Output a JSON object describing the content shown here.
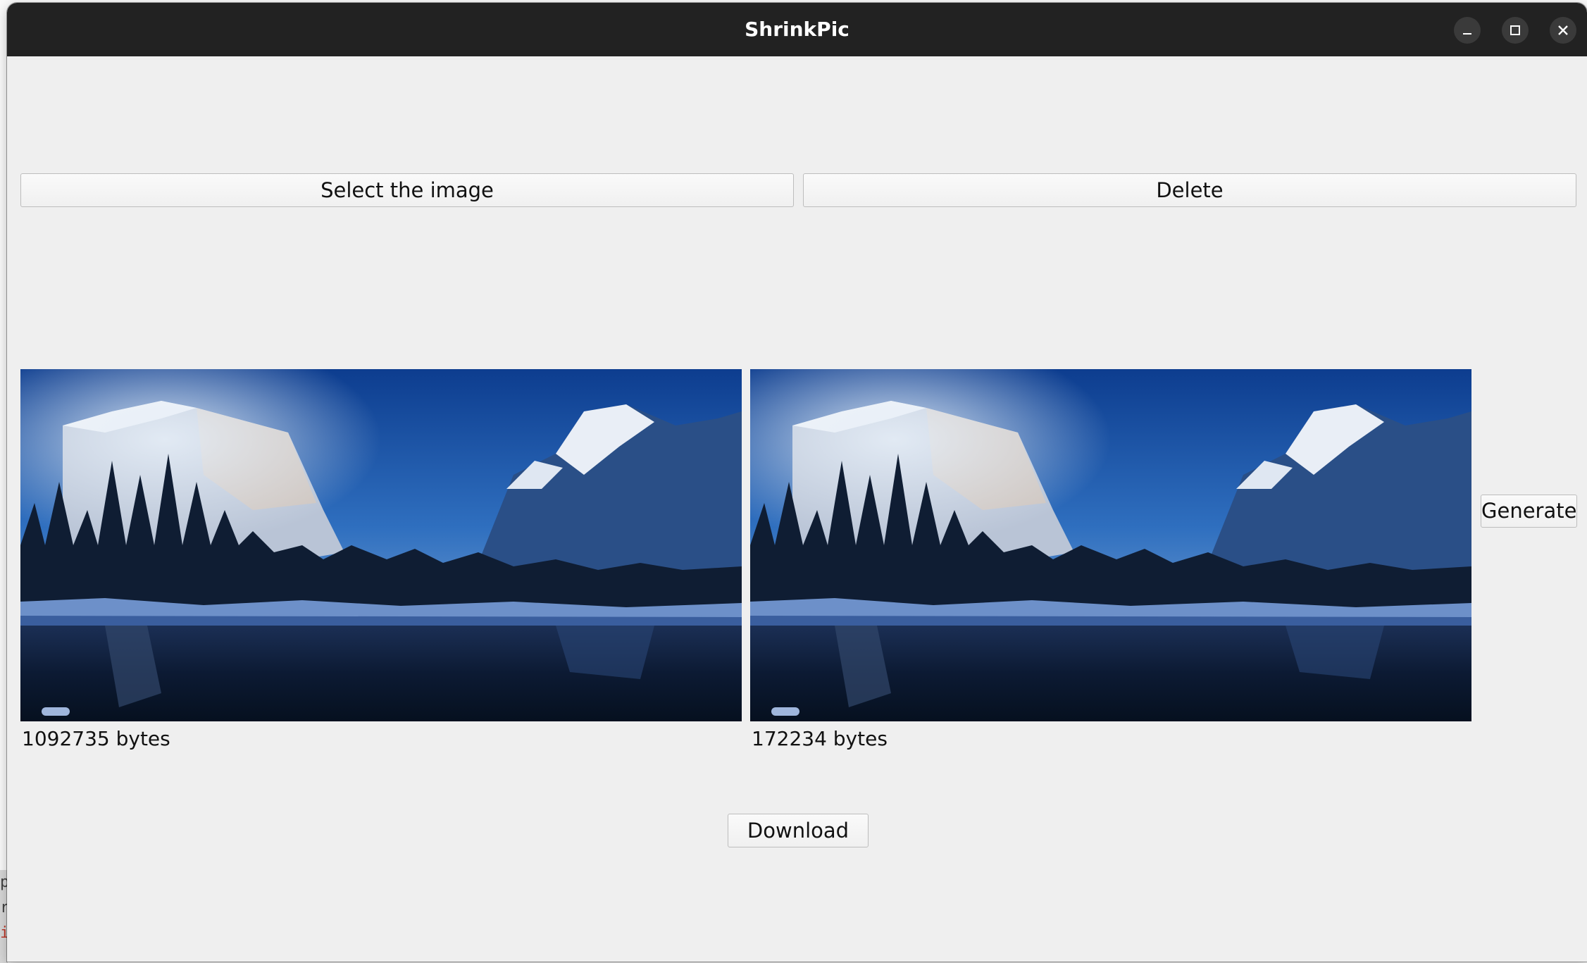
{
  "window": {
    "title": "ShrinkPic",
    "controls": {
      "minimize": "minimize-icon",
      "maximize": "maximize-icon",
      "close": "close-icon"
    }
  },
  "toolbar": {
    "select_label": "Select the image",
    "delete_label": "Delete"
  },
  "images": {
    "original": {
      "size_text": "1092735 bytes"
    },
    "compressed": {
      "size_text": "172234 bytes"
    }
  },
  "actions": {
    "generate_label": "Generate",
    "download_label": "Download"
  },
  "colors": {
    "titlebar": "#222222",
    "window_bg": "#efefef",
    "button_border": "#bdbdbd"
  }
}
